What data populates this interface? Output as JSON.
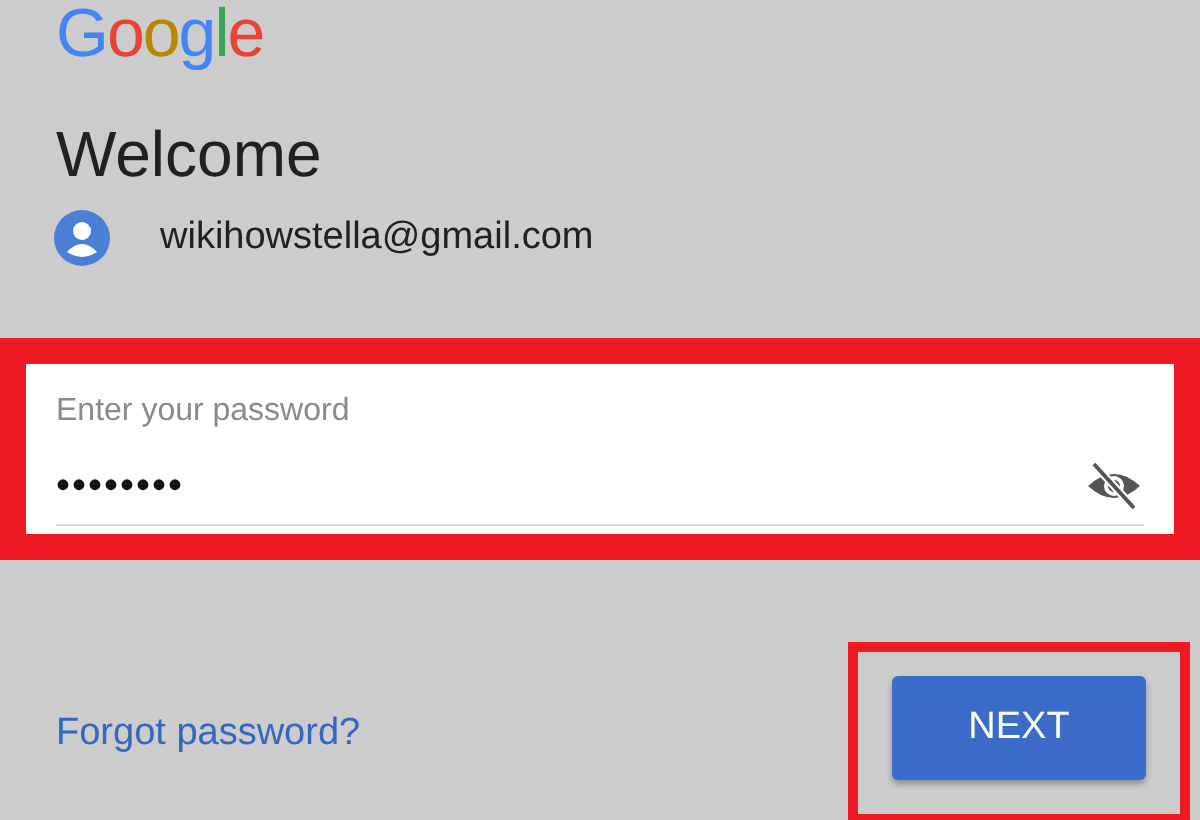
{
  "logo": "Google",
  "heading": "Welcome",
  "account": {
    "email": "wikihowstella@gmail.com"
  },
  "password_field": {
    "label": "Enter your password",
    "value": "••••••••"
  },
  "forgot_link": "Forgot password?",
  "next_button": "NEXT"
}
